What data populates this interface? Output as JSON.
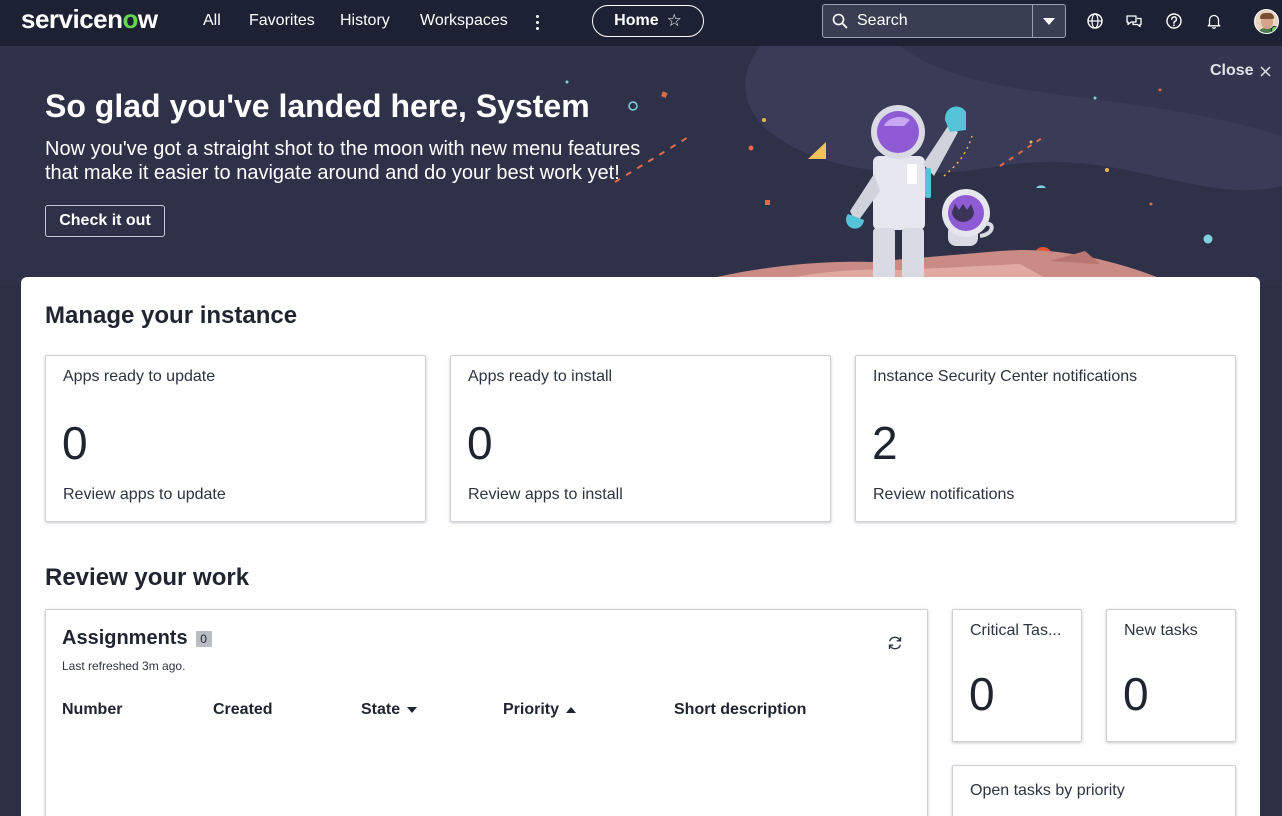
{
  "nav": {
    "logo_pre": "servicen",
    "logo_o": "o",
    "logo_post": "w",
    "items": [
      "All",
      "Favorites",
      "History",
      "Workspaces"
    ],
    "home_label": "Home",
    "search_placeholder": "Search"
  },
  "hero": {
    "title": "So glad you've landed here, System",
    "subtitle": "Now you've got a straight shot to the moon with new menu features that make it easier to navigate around and do your best work yet!",
    "cta_label": "Check it out",
    "close_label": "Close"
  },
  "manage": {
    "title": "Manage your instance",
    "tiles": [
      {
        "label": "Apps ready to update",
        "value": "0",
        "link": "Review apps to update"
      },
      {
        "label": "Apps ready to install",
        "value": "0",
        "link": "Review apps to install"
      },
      {
        "label": "Instance Security Center notifications",
        "value": "2",
        "link": "Review notifications"
      }
    ]
  },
  "review": {
    "title": "Review your work",
    "assignments": {
      "title": "Assignments",
      "count": "0",
      "refreshed": "Last refreshed 3m ago.",
      "columns": [
        "Number",
        "Created",
        "State",
        "Priority",
        "Short description"
      ]
    },
    "side_tiles": [
      {
        "label": "Critical Tas...",
        "value": "0"
      },
      {
        "label": "New tasks",
        "value": "0"
      }
    ],
    "open_tasks_title": "Open tasks by priority"
  },
  "colors": {
    "nav_bg": "#1d2134",
    "hero_bg": "#2f3149",
    "accent_green": "#62d84e"
  }
}
